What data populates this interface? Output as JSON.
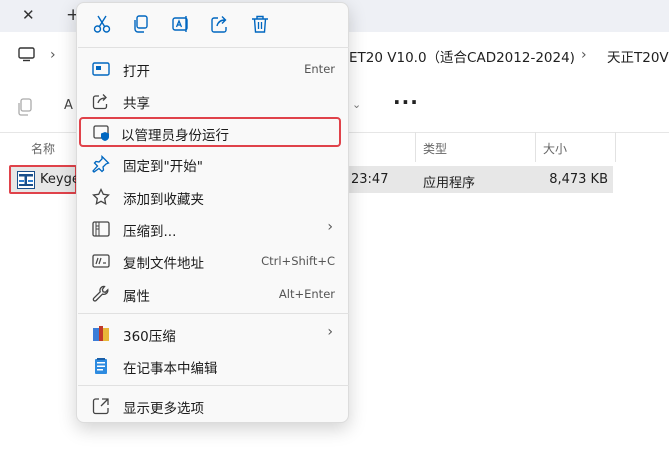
{
  "tabs": {
    "close": "✕",
    "add": "+"
  },
  "address": {
    "crumb1": "ET20 V10.0（适合CAD2012-2024)",
    "crumb2": "天正T20V"
  },
  "toolbar": {
    "more": "···",
    "rename_letter": "A"
  },
  "columns": {
    "name": "名称",
    "type": "类型",
    "size": "大小"
  },
  "file": {
    "name": "Keyge",
    "time": "23:47",
    "type": "应用程序",
    "size": "8,473 KB"
  },
  "menu": {
    "quick_actions": [
      "cut-icon",
      "copy-icon",
      "rename-icon",
      "share-icon",
      "delete-icon"
    ],
    "items": [
      {
        "label": "打开",
        "shortcut": "Enter",
        "icon": "open-icon"
      },
      {
        "label": "共享",
        "shortcut": "",
        "icon": "share-icon"
      },
      {
        "label": "以管理员身份运行",
        "shortcut": "",
        "icon": "shield-icon"
      },
      {
        "label": "固定到\"开始\"",
        "shortcut": "",
        "icon": "pin-icon"
      },
      {
        "label": "添加到收藏夹",
        "shortcut": "",
        "icon": "star-icon"
      },
      {
        "label": "压缩到...",
        "shortcut": "",
        "icon": "zip-icon",
        "submenu": true
      },
      {
        "label": "复制文件地址",
        "shortcut": "Ctrl+Shift+C",
        "icon": "path-icon"
      },
      {
        "label": "属性",
        "shortcut": "Alt+Enter",
        "icon": "wrench-icon"
      },
      {
        "label": "360压缩",
        "shortcut": "",
        "icon": "archive-icon",
        "submenu": true
      },
      {
        "label": "在记事本中编辑",
        "shortcut": "",
        "icon": "notepad-icon"
      },
      {
        "label": "显示更多选项",
        "shortcut": "",
        "icon": "more-options-icon"
      }
    ]
  },
  "colors": {
    "highlight": "#e0424a",
    "accent": "#0067c0"
  }
}
